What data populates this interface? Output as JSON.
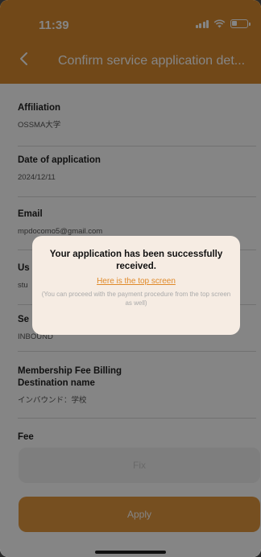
{
  "status_bar": {
    "time": "11:39"
  },
  "header": {
    "title": "Confirm service application det..."
  },
  "fields": [
    {
      "label": "Affiliation",
      "value": "OSSMA大学"
    },
    {
      "label": "Date of application",
      "value": "2024/12/11"
    },
    {
      "label": "Email",
      "value": "mpdocomo5@gmail.com"
    },
    {
      "label": "Us",
      "value": "stu"
    },
    {
      "label": "Se",
      "value": "INBOUND"
    },
    {
      "label": "Membership Fee Billing\nDestination name",
      "value": "インバウンド：学校"
    },
    {
      "label": "Fee",
      "value": ""
    }
  ],
  "buttons": {
    "fix": "Fix",
    "apply": "Apply"
  },
  "modal": {
    "message": "Your application has been successfully received.",
    "link": "Here is the top screen",
    "note": "(You can proceed with the payment procedure from the top screen as well)"
  },
  "colors": {
    "brand": "#d98a2e",
    "apply": "#e3973f",
    "link": "#e08a2a"
  },
  "icons": [
    "wifi-icon",
    "cellular-signal-icon",
    "battery-icon",
    "back-chevron-icon"
  ]
}
